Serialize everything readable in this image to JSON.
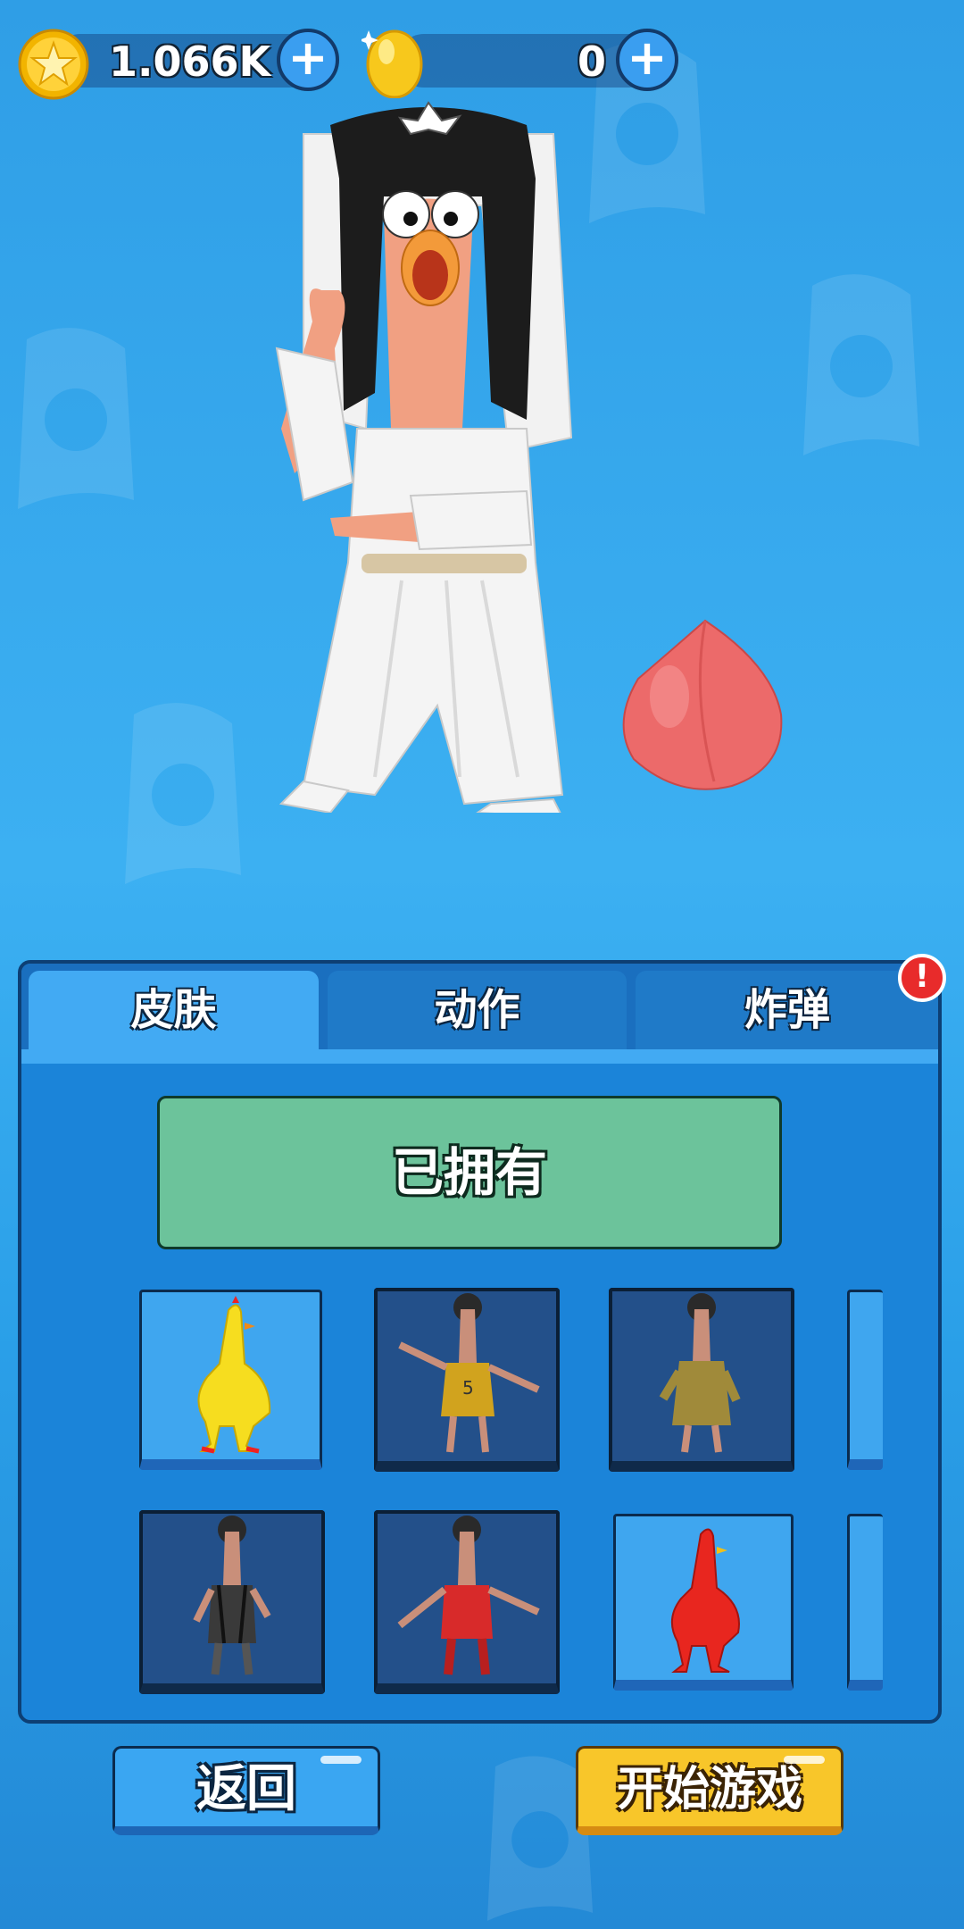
{
  "currency": {
    "coins": {
      "value": "1.066K",
      "icon": "star-coin-icon"
    },
    "eggs": {
      "value": "0",
      "icon": "golden-egg-icon"
    },
    "plus_symbol": "+"
  },
  "tabs": [
    {
      "label": "皮肤",
      "active": true
    },
    {
      "label": "动作",
      "active": false
    },
    {
      "label": "炸弹",
      "active": false
    }
  ],
  "alert_badge": "!",
  "owned_label": "已拥有",
  "skins": [
    {
      "name": "yellow-chicken",
      "selected": true,
      "locked": false
    },
    {
      "name": "basketball-chicken",
      "selected": false,
      "locked": true
    },
    {
      "name": "yellow-robe-chicken",
      "selected": false,
      "locked": true
    },
    {
      "name": "suspenders-chicken",
      "selected": false,
      "locked": true
    },
    {
      "name": "red-jacket-chicken",
      "selected": false,
      "locked": true
    },
    {
      "name": "red-chicken",
      "selected": false,
      "locked": false
    }
  ],
  "buttons": {
    "back": "返回",
    "start": "开始游戏"
  },
  "colors": {
    "background": "#34a8ee",
    "panel": "#1b84d9",
    "owned": "#6cc39b",
    "start": "#f8c62a",
    "back": "#3aa6f2"
  }
}
